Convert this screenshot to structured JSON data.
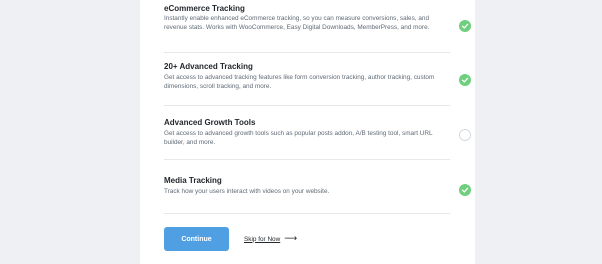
{
  "features": [
    {
      "title": "eCommerce Tracking",
      "description": "Instantly enable enhanced eCommerce tracking, so you can measure conversions, sales, and revenue stats. Works with WooCommerce, Easy Digital Downloads, MemberPress, and more.",
      "checked": true
    },
    {
      "title": "20+ Advanced Tracking",
      "description": "Get access to advanced tracking features like form conversion tracking, author tracking, custom dimensions, scroll tracking, and more.",
      "checked": true
    },
    {
      "title": "Advanced Growth Tools",
      "description": "Get access to advanced growth tools such as popular posts addon, A/B testing tool, smart URL builder, and more.",
      "checked": false
    },
    {
      "title": "Media Tracking",
      "description": "Track how your users interact with videos on your website.",
      "checked": true
    }
  ],
  "actions": {
    "continue_label": "Continue",
    "skip_label": "Skip for Now",
    "skip_arrow": "⟶"
  },
  "colors": {
    "background": "#eef0f3",
    "card": "#ffffff",
    "primary_button": "#509fe2",
    "check_on": "#6fcf7f",
    "check_off_border": "#d5d9de"
  },
  "icons": {
    "checked": "checkmark-icon",
    "unchecked": "empty-circle-icon",
    "skip": "arrow-right-icon"
  }
}
